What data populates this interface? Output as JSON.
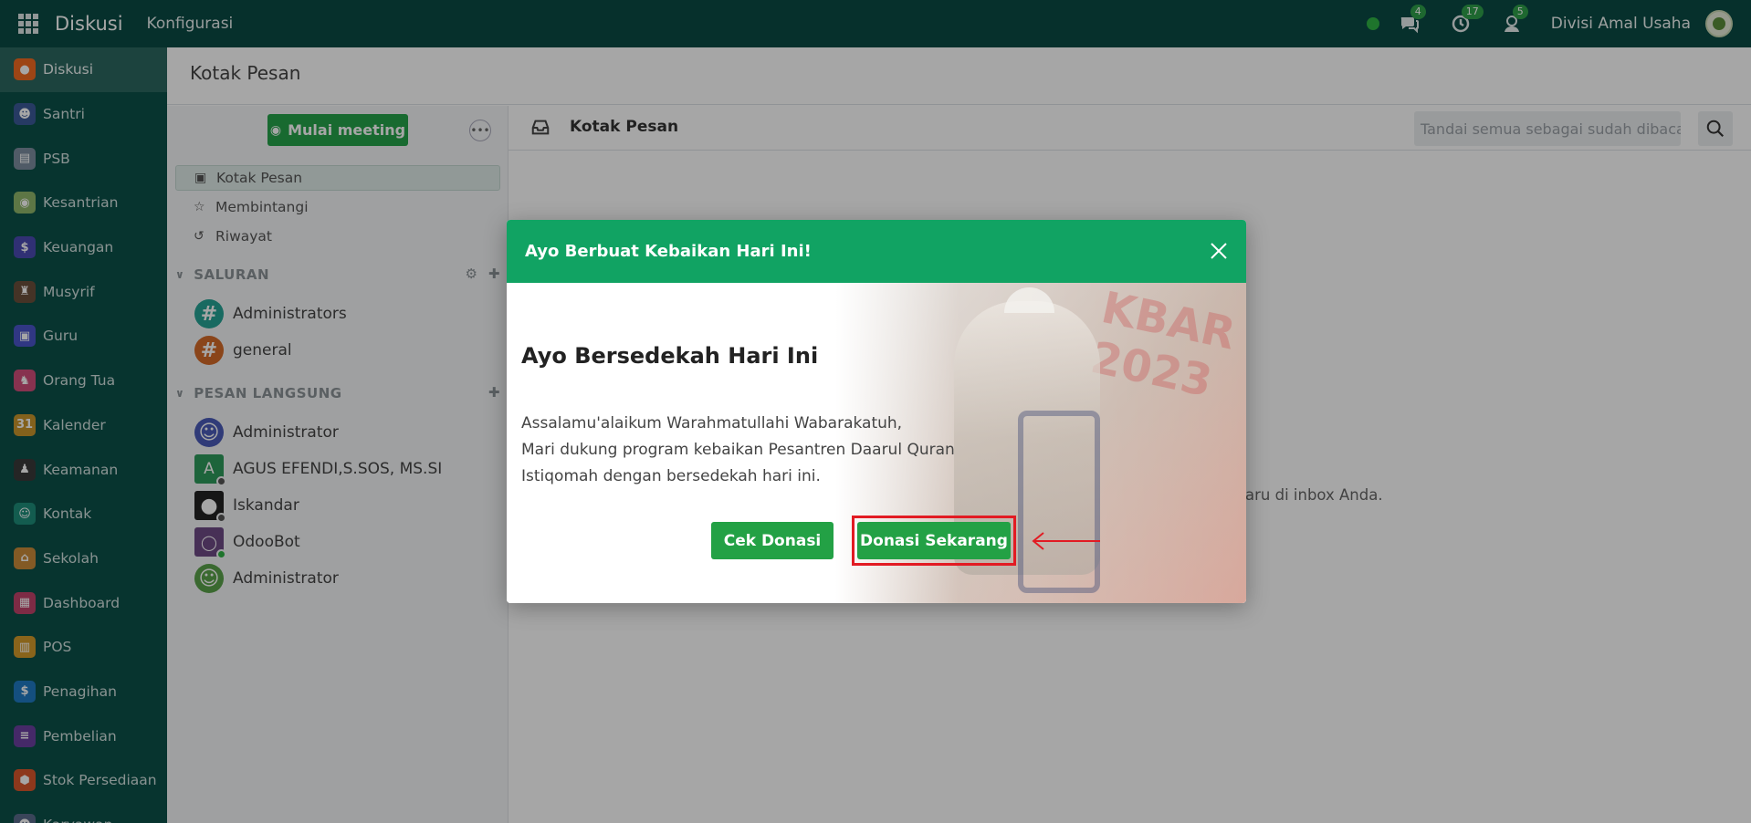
{
  "topbar": {
    "brand": "Diskusi",
    "menu": "Konfigurasi",
    "badges": {
      "messages": "4",
      "activities": "17",
      "notifications": "5"
    },
    "company": "Divisi Amal Usaha"
  },
  "apps": [
    {
      "label": "Diskusi",
      "color": "#f26b21",
      "glyph": "●"
    },
    {
      "label": "Santri",
      "color": "#3b5998",
      "glyph": "☻"
    },
    {
      "label": "PSB",
      "color": "#7b8d9e",
      "glyph": "▤"
    },
    {
      "label": "Kesantrian",
      "color": "#8fb56a",
      "glyph": "◉"
    },
    {
      "label": "Keuangan",
      "color": "#4b4ab2",
      "glyph": "$"
    },
    {
      "label": "Musyrif",
      "color": "#6b4f3b",
      "glyph": "♜"
    },
    {
      "label": "Guru",
      "color": "#4a55c9",
      "glyph": "▣"
    },
    {
      "label": "Orang Tua",
      "color": "#cf4e7a",
      "glyph": "♞"
    },
    {
      "label": "Kalender",
      "color": "#c9962b",
      "glyph": "31"
    },
    {
      "label": "Keamanan",
      "color": "#3a3a3a",
      "glyph": "♟"
    },
    {
      "label": "Kontak",
      "color": "#1e8e7a",
      "glyph": "☺"
    },
    {
      "label": "Sekolah",
      "color": "#c98b3a",
      "glyph": "⌂"
    },
    {
      "label": "Dashboard",
      "color": "#c0426b",
      "glyph": "▦"
    },
    {
      "label": "POS",
      "color": "#d39a2a",
      "glyph": "▥"
    },
    {
      "label": "Penagihan",
      "color": "#1f7ac4",
      "glyph": "$"
    },
    {
      "label": "Pembelian",
      "color": "#6a3fa0",
      "glyph": "≡"
    },
    {
      "label": "Stok Persediaan",
      "color": "#d9572b",
      "glyph": "⬢"
    },
    {
      "label": "Karyawan",
      "color": "#5a6b8a",
      "glyph": "☻"
    }
  ],
  "page": {
    "title": "Kotak Pesan"
  },
  "sidebar": {
    "meeting_button": "Mulai meeting",
    "mailboxes": [
      {
        "label": "Kotak Pesan",
        "icon": "inbox-icon"
      },
      {
        "label": "Membintangi",
        "icon": "star-icon"
      },
      {
        "label": "Riwayat",
        "icon": "history-icon"
      }
    ],
    "channels_title": "SALURAN",
    "channels": [
      {
        "label": "Administrators",
        "color": "#26a395"
      },
      {
        "label": "general",
        "color": "#d56a29"
      }
    ],
    "dm_title": "PESAN LANGSUNG",
    "direct_messages": [
      {
        "label": "Administrator",
        "color": "#4a5bb8"
      },
      {
        "label": "AGUS EFENDI,S.SOS, MS.SI",
        "color": "#2d9a5b",
        "letter": "A"
      },
      {
        "label": "Iskandar",
        "color": "#222222"
      },
      {
        "label": "OdooBot",
        "color": "#6e4a85"
      },
      {
        "label": "Administrator",
        "color": "#5aa24a"
      }
    ]
  },
  "thread": {
    "title": "Kotak Pesan",
    "mark_read_placeholder": "Tandai semua sebagai sudah dibaca",
    "empty_text_fragment": "aru di inbox Anda."
  },
  "modal": {
    "header": "Ayo Berbuat Kebaikan Hari Ini!",
    "title": "Ayo Bersedekah Hari Ini",
    "line1": "Assalamu'alaikum Warahmatullahi Wabarakatuh,",
    "line2": "Mari dukung program kebaikan Pesantren Daarul Quran",
    "line3": "Istiqomah dengan bersedekah hari ini.",
    "banner": "KBAR 2023",
    "cek_button": "Cek Donasi",
    "donate_button": "Donasi Sekarang"
  },
  "colors": {
    "topbar": "#0a4b44",
    "accent": "#11a363",
    "button": "#23a145",
    "highlight": "#e21b23"
  }
}
